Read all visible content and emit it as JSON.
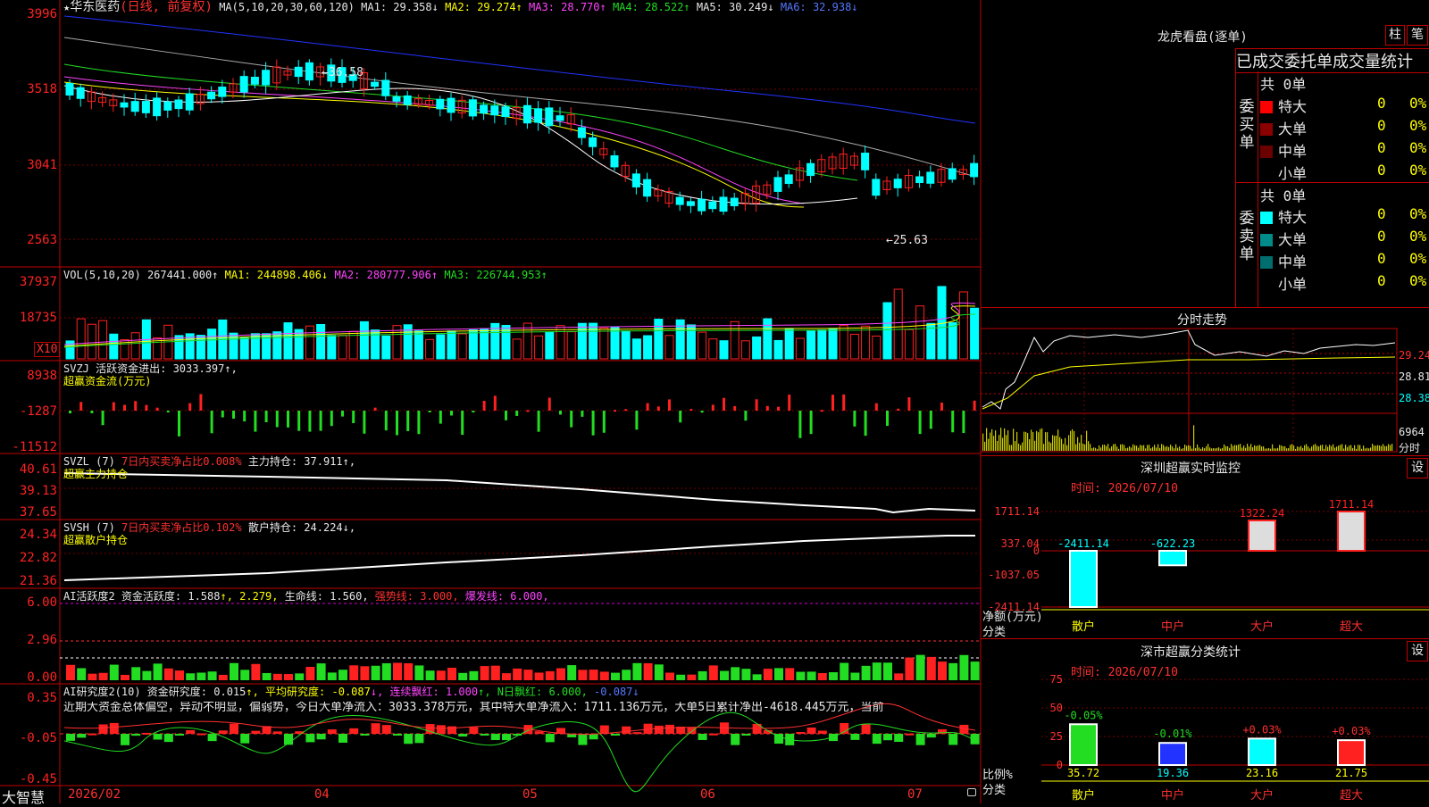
{
  "stock": {
    "star": "★",
    "name": "华东医药",
    "period": "(日线, 前复权)",
    "ma_params": "MA(5,10,20,30,60,120)",
    "ma1": "MA1: 29.358↓",
    "ma2": "MA2: 29.274↑",
    "ma3": "MA3: 28.770↑",
    "ma4": "MA4: 28.522↑",
    "ma5": "MA5: 30.249↓",
    "ma6": "MA6: 32.938↓",
    "high_mark": "←36.58",
    "low_mark": "←25.63",
    "y_labels": [
      "3996",
      "3518",
      "3041",
      "2563"
    ]
  },
  "vol": {
    "params": "VOL(5,10,20)",
    "value": "267441.000↑",
    "ma1": "MA1: 244898.406↓",
    "ma2": "MA2: 280777.906↑",
    "ma3": "MA3: 226744.953↑",
    "y_labels": [
      "37937",
      "18735"
    ],
    "unit": "X10"
  },
  "svzj": {
    "title": "SVZJ  活跃资金进出: 3033.397↑,",
    "subtitle": "超赢资金流(万元)",
    "y_labels": [
      "8938",
      "-1287",
      "-11512"
    ]
  },
  "svzl": {
    "params": "SVZL (7)",
    "ratio": "7日内买卖净占比0.008%",
    "hold": "主力持仓: 37.911↑,",
    "subtitle": "超赢主力持仓",
    "y_labels": [
      "40.61",
      "39.13",
      "37.65"
    ]
  },
  "svsh": {
    "params": "SVSH (7)",
    "ratio": "7日内买卖净占比0.102%",
    "hold": "散户持仓: 24.224↓,",
    "subtitle": "超赢散户持仓",
    "y_labels": [
      "24.34",
      "22.82",
      "21.36"
    ]
  },
  "ai_active": {
    "title": "AI活跃度2 资金活跃度: 1.588",
    "v2": "↑, 2.279,",
    "life": "生命线: 1.560,",
    "strong": "强势线: 3.000,",
    "burst": "爆发线: 6.000,",
    "y_labels": [
      "6.00",
      "2.96",
      "0.00"
    ]
  },
  "ai_research": {
    "title": "AI研究度2(10) 资金研究度: 0.015",
    "avg": "↑, 平均研究度: -0.087",
    "red": "↓, 连续飘红: 1.000",
    "nred": "↑, N日飘红: 6.000,",
    "last": "-0.087↓",
    "comment": "近期大资金总体偏空，异动不明显，偏弱势，今日大单净流入：3033.378万元，其中特大单净流入：1711.136万元，大单5日累计净出-4618.445万元，当前",
    "y_labels": [
      "0.35",
      "-0.05",
      "-0.45"
    ]
  },
  "x_axis": {
    "brand": "大智慧",
    "labels": [
      "2026/02",
      "04",
      "05",
      "06",
      "07"
    ]
  },
  "longhu": {
    "title": "龙虎看盘(逐单)",
    "btn_bar": "柱",
    "btn_pen": "笔",
    "header": "已成交委托单成交量统计",
    "buy_label": "委买单",
    "sell_label": "委卖单",
    "buy_total": "共 0单",
    "sell_total": "共 0单",
    "buy_rows": [
      {
        "label": "特大",
        "count": "0",
        "pct": "0%",
        "color": "#ff0000"
      },
      {
        "label": "大单",
        "count": "0",
        "pct": "0%",
        "color": "#8b0000"
      },
      {
        "label": "中单",
        "count": "0",
        "pct": "0%",
        "color": "#6a0000"
      },
      {
        "label": "小单",
        "count": "0",
        "pct": "0%",
        "color": "#000000"
      }
    ],
    "sell_rows": [
      {
        "label": "特大",
        "count": "0",
        "pct": "0%",
        "color": "#00ffff"
      },
      {
        "label": "大单",
        "count": "0",
        "pct": "0%",
        "color": "#008b8b"
      },
      {
        "label": "中单",
        "count": "0",
        "pct": "0%",
        "color": "#006e6e"
      },
      {
        "label": "小单",
        "count": "0",
        "pct": "0%",
        "color": "#000000"
      }
    ]
  },
  "fenshi": {
    "title": "分时走势",
    "labels": [
      "29.24",
      "28.81",
      "28.38"
    ],
    "vol_label": "6964",
    "unit": "分时"
  },
  "monitor": {
    "title": "深圳超赢实时监控",
    "btn": "设",
    "time": "时间: 2026/07/10",
    "y_labels": [
      "1711.14",
      "337.04",
      "0",
      "-1037.05",
      "-2411.14"
    ],
    "ylabel": "净额(万元)",
    "xlabel": "分类",
    "categories": [
      "散户",
      "中户",
      "大户",
      "超大"
    ],
    "values": [
      -2411.14,
      -622.23,
      1322.24,
      1711.14
    ],
    "value_labels": [
      "-2411.14",
      "-622.23",
      "1322.24",
      "1711.14"
    ]
  },
  "classify": {
    "title": "深市超赢分类统计",
    "btn": "设",
    "time": "时间: 2026/07/10",
    "y_labels": [
      "75",
      "50",
      "25",
      "0"
    ],
    "ylabel": "比例%",
    "xlabel": "分类",
    "categories": [
      "散户",
      "中户",
      "大户",
      "超大"
    ],
    "values": [
      35.72,
      19.36,
      23.16,
      21.75
    ],
    "value_labels": [
      "35.72",
      "19.36",
      "23.16",
      "21.75"
    ],
    "change_labels": [
      "-0.05%",
      "-0.01%",
      "+0.03%",
      "+0.03%"
    ]
  },
  "colors": {
    "up": "#ff2020",
    "down": "#00ffff",
    "frame": "#c00000"
  }
}
